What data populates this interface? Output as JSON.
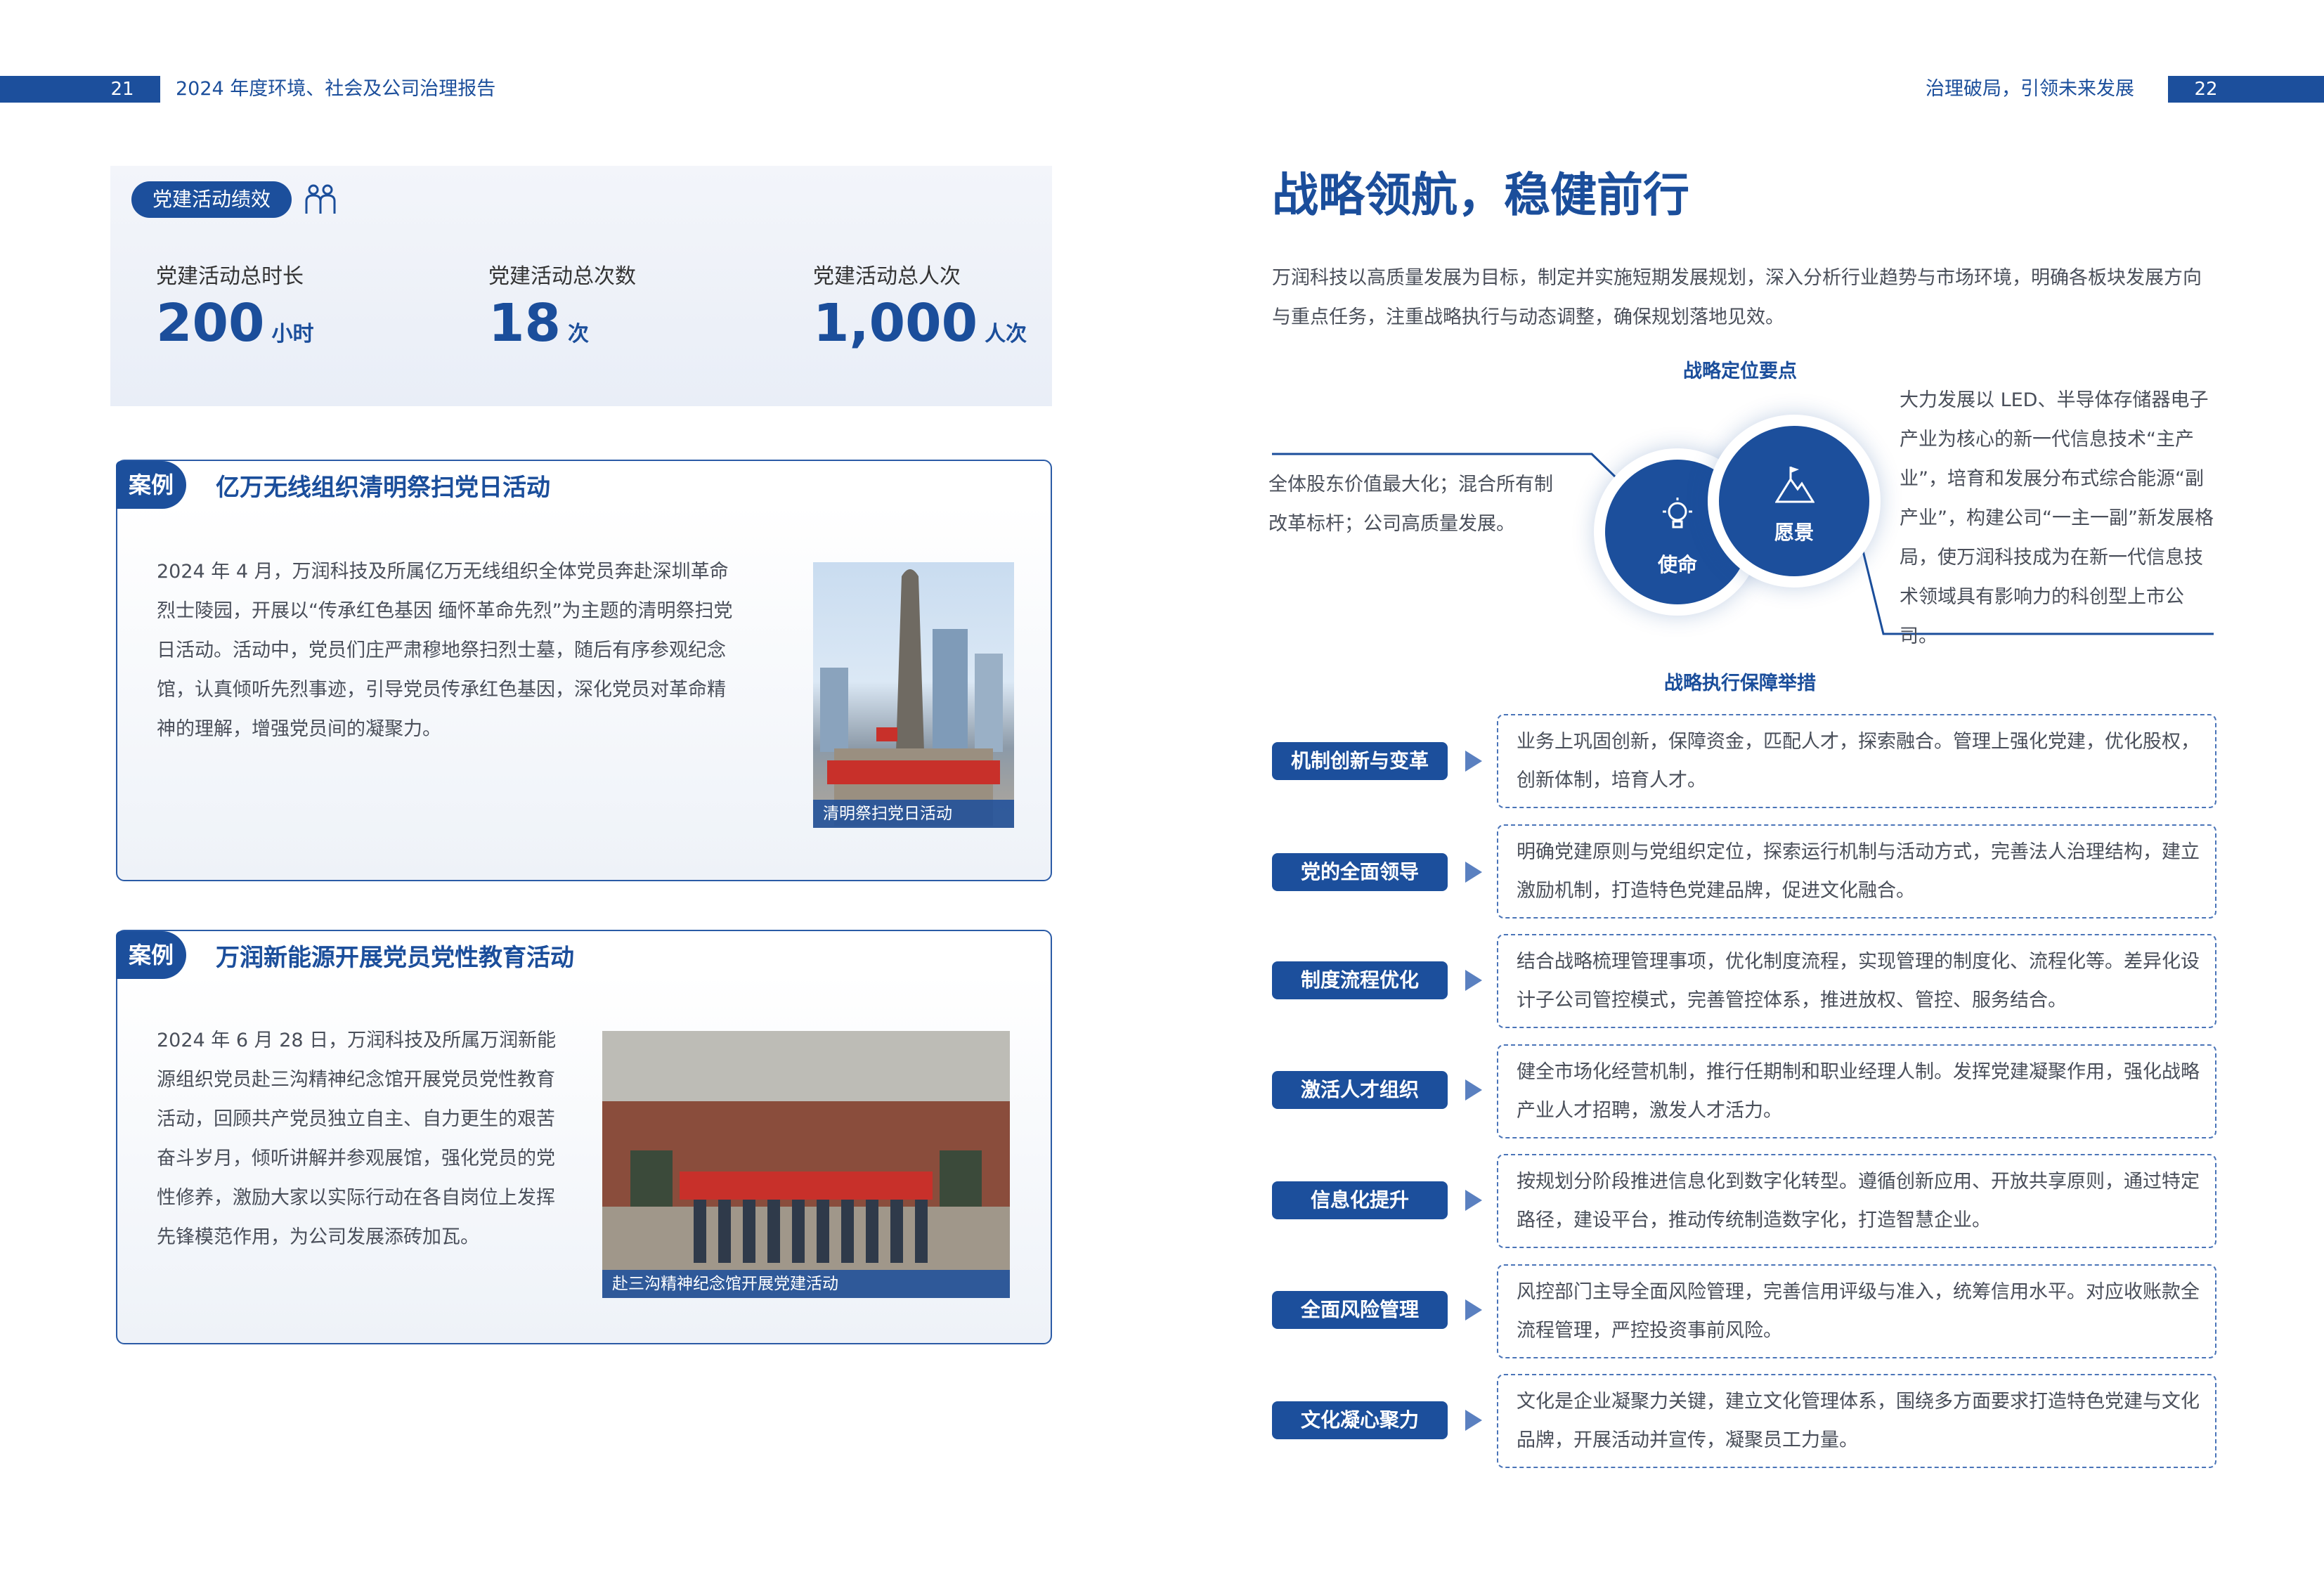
{
  "header": {
    "left_page_number": "21",
    "left_title": "2024 年度环境、社会及公司治理报告",
    "right_title": "治理破局，引领未来发展",
    "right_page_number": "22"
  },
  "party_stats": {
    "badge": "党建活动绩效",
    "icon": "people-icon",
    "items": [
      {
        "label": "党建活动总时长",
        "value": "200",
        "unit": "小时"
      },
      {
        "label": "党建活动总次数",
        "value": "18",
        "unit": "次"
      },
      {
        "label": "党建活动总人次",
        "value": "1,000",
        "unit": "人次"
      }
    ]
  },
  "cases": [
    {
      "tab": "案例",
      "title": "亿万无线组织清明祭扫党日活动",
      "body": "2024 年 4 月，万润科技及所属亿万无线组织全体党员奔赴深圳革命烈士陵园，开展以“传承红色基因 缅怀革命先烈”为主题的清明祭扫党日活动。活动中，党员们庄严肃穆地祭扫烈士墓，随后有序参观纪念馆，认真倾听先烈事迹，引导党员传承红色基因，深化党员对革命精神的理解，增强党员间的凝聚力。",
      "photo_caption": "清明祭扫党日活动"
    },
    {
      "tab": "案例",
      "title": "万润新能源开展党员党性教育活动",
      "body": "2024 年 6 月 28 日，万润科技及所属万润新能源组织党员赴三沟精神纪念馆开展党员党性教育活动，回顾共产党员独立自主、自力更生的艰苦奋斗岁月，倾听讲解并参观展馆，强化党员的党性修养，激励大家以实际行动在各自岗位上发挥先锋模范作用，为公司发展添砖加瓦。",
      "photo_caption": "赴三沟精神纪念馆开展党建活动"
    }
  ],
  "strategy": {
    "title": "战略领航，稳健前行",
    "intro": "万润科技以高质量发展为目标，制定并实施短期发展规划，深入分析行业趋势与市场环境，明确各板块发展方向与重点任务，注重战略执行与动态调整，确保规划落地见效。",
    "positioning_heading": "战略定位要点",
    "mission_label": "使命",
    "mission_icon": "lightbulb-icon",
    "mission_text": "全体股东价值最大化；混合所有制改革标杆；公司高质量发展。",
    "vision_label": "愿景",
    "vision_icon": "mountain-flag-icon",
    "vision_text": "大力发展以 LED、半导体存储器电子产业为核心的新一代信息技术“主产业”，培育和发展分布式综合能源“副产业”，构建公司“一主一副”新发展格局，使万润科技成为在新一代信息技术领域具有影响力的科创型上市公司。",
    "measures_heading": "战略执行保障举措",
    "measures": [
      {
        "label": "机制创新与变革",
        "text": "业务上巩固创新，保障资金，匹配人才，探索融合。管理上强化党建，优化股权，创新体制，培育人才。"
      },
      {
        "label": "党的全面领导",
        "text": "明确党建原则与党组织定位，探索运行机制与活动方式，完善法人治理结构，建立激励机制，打造特色党建品牌，促进文化融合。"
      },
      {
        "label": "制度流程优化",
        "text": "结合战略梳理管理事项，优化制度流程，实现管理的制度化、流程化等。差异化设计子公司管控模式，完善管控体系，推进放权、管控、服务结合。"
      },
      {
        "label": "激活人才组织",
        "text": "健全市场化经营机制，推行任期制和职业经理人制。发挥党建凝聚作用，强化战略产业人才招聘，激发人才活力。"
      },
      {
        "label": "信息化提升",
        "text": "按规划分阶段推进信息化到数字化转型。遵循创新应用、开放共享原则，通过特定路径，建设平台，推动传统制造数字化，打造智慧企业。"
      },
      {
        "label": "全面风险管理",
        "text": "风控部门主导全面风险管理，完善信用评级与准入，统筹信用水平。对应收账款全流程管理，严控投资事前风险。"
      },
      {
        "label": "文化凝心聚力",
        "text": "文化是企业凝聚力关键，建立文化管理体系，围绕多方面要求打造特色党建与文化品牌，开展活动并宣传，凝聚员工力量。"
      }
    ]
  }
}
